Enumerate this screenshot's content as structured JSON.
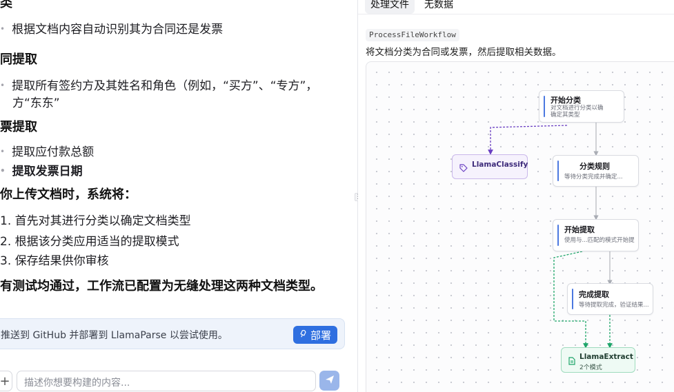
{
  "chat": {
    "section_classify_heading": "类",
    "classify_bullet": "根据文档内容自动识别其为合同还是发票",
    "contract_heading": "同提取",
    "contract_bullet_line1": "提取所有签约方及其姓名和角色（例如，“买方”、“专方”，",
    "contract_bullet_line2": "方“东东”",
    "invoice_heading": "票提取",
    "invoice_bullets": [
      "提取应付款总额",
      "提取发票日期"
    ],
    "upload_heading": "你上传文档时，系统将：",
    "steps": [
      "1. 首先对其进行分类以确定文档类型",
      "2. 根据该分类应用适当的提取模式",
      "3. 保存结果供你审核"
    ],
    "conclusion": "有测试均通过，工作流已配置为无缝处理这两种文档类型。"
  },
  "notice": {
    "text": "推送到 GitHub 并部署到 LlamaParse 以尝试使用。",
    "deploy_label": "部署",
    "deploy_icon": "rocket-icon"
  },
  "input": {
    "placeholder": "描述你想要构建的内容...",
    "plus_label": "+",
    "send_icon": "send-icon"
  },
  "tabs": [
    "处理文件",
    "无数据"
  ],
  "workflow": {
    "name": "ProcessFileWorkflow",
    "description": "将文档分类为合同或发票，然后提取相关数据。",
    "nodes": {
      "start_classify": {
        "title": "开始分类",
        "subtitle_line1": "对文档进行分类以确",
        "subtitle_line2": "确定其类型"
      },
      "classify_rules": {
        "title": "分类规则",
        "subtitle": "等待分类完成并确定..."
      },
      "start_extract": {
        "title": "开始提取",
        "subtitle": "使用与...匹配的模式开始提"
      },
      "finish_extract": {
        "title": "完成提取",
        "subtitle": "等待提取完成，验证结果..."
      }
    },
    "services": {
      "classify": {
        "title": "LlamaClassify",
        "icon": "tag-icon"
      },
      "extract": {
        "title": "LlamaExtract",
        "subtitle": "2个模式",
        "icon": "document-icon"
      }
    }
  },
  "colors": {
    "accent_blue": "#2f6fe0",
    "classify_purple": "#6a3fc2",
    "extract_green": "#1ea56a"
  }
}
